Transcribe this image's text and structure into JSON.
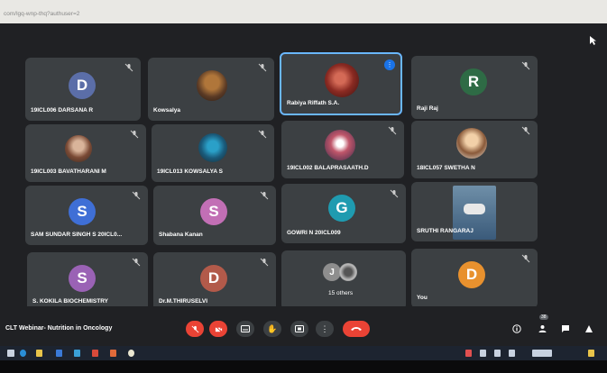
{
  "browser": {
    "url": "com/lgq-wnp-thq?authuser=2"
  },
  "participants": [
    {
      "name": "19ICL006 DARSANA R",
      "initial": "D",
      "color": "#5b6ea8",
      "muted": true
    },
    {
      "name": "Kowsalya",
      "initial": "",
      "color": "#7a5b3d",
      "muted": true
    },
    {
      "name": "Rabiya Riffath S.A.",
      "initial": "",
      "color": "#8a3a2a",
      "muted": false,
      "speaking": true
    },
    {
      "name": "Raji Raj",
      "initial": "R",
      "color": "#2e6b45",
      "muted": true
    },
    {
      "name": "19ICL003 BAVATHARANI M",
      "initial": "",
      "color": "#8a6b55",
      "muted": true
    },
    {
      "name": "19ICL013 KOWSALYA S",
      "initial": "",
      "color": "#3b6f8a",
      "muted": true
    },
    {
      "name": "19ICL002 BALAPRASAATH.D",
      "initial": "",
      "color": "#9a5560",
      "muted": true
    },
    {
      "name": "18ICL057 SWETHA N",
      "initial": "",
      "color": "#c9a27a",
      "muted": true
    },
    {
      "name": "SAM SUNDAR SINGH S 20ICL0...",
      "initial": "S",
      "color": "#3f6fd6",
      "muted": true
    },
    {
      "name": "Shabana Kanan",
      "initial": "S",
      "color": "#c26fb5",
      "muted": true
    },
    {
      "name": "GOWRI N 20ICL009",
      "initial": "G",
      "color": "#1f9bb0",
      "muted": true
    },
    {
      "name": "SRUTHI RANGARAJ",
      "initial": "",
      "color": "#4a6f8f",
      "muted": false
    },
    {
      "name": "S. KOKILA BIOCHEMISTRY",
      "initial": "S",
      "color": "#9a62b5",
      "muted": true
    },
    {
      "name": "Dr.M.THIRUSELVI",
      "initial": "D",
      "color": "#b25a4a",
      "muted": true
    },
    {
      "name": "15 others",
      "initial": "J",
      "color": "#8e8e8e",
      "muted": false
    },
    {
      "name": "You",
      "initial": "D",
      "color": "#e8912e",
      "muted": true
    }
  ],
  "meeting": {
    "title": "CLT Webinar- Nutrition in Oncology"
  },
  "controls": {
    "mic": "mic-off-icon",
    "camera": "camera-off-icon",
    "captions": "captions-icon",
    "hand": "raise-hand-icon",
    "present": "present-icon",
    "more": "more-options-icon",
    "hangup": "hang-up-icon"
  },
  "right_controls": {
    "info": "info-icon",
    "people_count": "38",
    "people": "people-icon",
    "chat": "chat-icon",
    "activities": "activities-icon"
  },
  "colors": {
    "accent": "#1a73e8",
    "hangup": "#ea4335",
    "background": "#202124",
    "tile": "#3c4043"
  }
}
